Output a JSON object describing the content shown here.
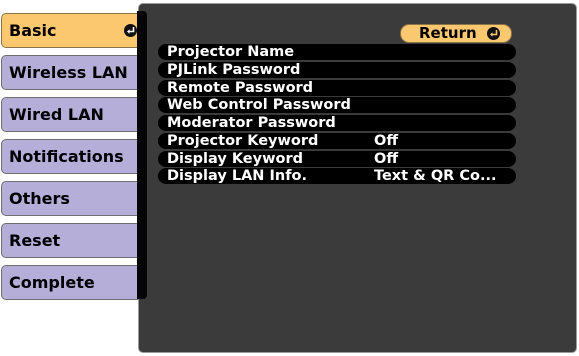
{
  "sidebar": {
    "tabs": [
      {
        "label": "Basic",
        "selected": true
      },
      {
        "label": "Wireless LAN",
        "selected": false
      },
      {
        "label": "Wired LAN",
        "selected": false
      },
      {
        "label": "Notifications",
        "selected": false
      },
      {
        "label": "Others",
        "selected": false
      },
      {
        "label": "Reset",
        "selected": false
      },
      {
        "label": "Complete",
        "selected": false
      }
    ],
    "selected_icon": "enter-icon"
  },
  "panel": {
    "return_button": {
      "label": "Return",
      "icon": "enter-icon"
    },
    "items": [
      {
        "label": "Projector Name",
        "value": ""
      },
      {
        "label": "PJLink Password",
        "value": ""
      },
      {
        "label": "Remote Password",
        "value": ""
      },
      {
        "label": "Web Control Password",
        "value": ""
      },
      {
        "label": "Moderator Password",
        "value": ""
      },
      {
        "label": "Projector Keyword",
        "value": "Off"
      },
      {
        "label": "Display Keyword",
        "value": "Off"
      },
      {
        "label": "Display LAN Info.",
        "value": "Text & QR Co..."
      }
    ]
  },
  "colors": {
    "selected_tab": "#fcc86f",
    "unselected_tab": "#b4aed8",
    "panel_background": "#3b3b3b",
    "row_background": "#000000",
    "text_light": "#ffffff"
  }
}
